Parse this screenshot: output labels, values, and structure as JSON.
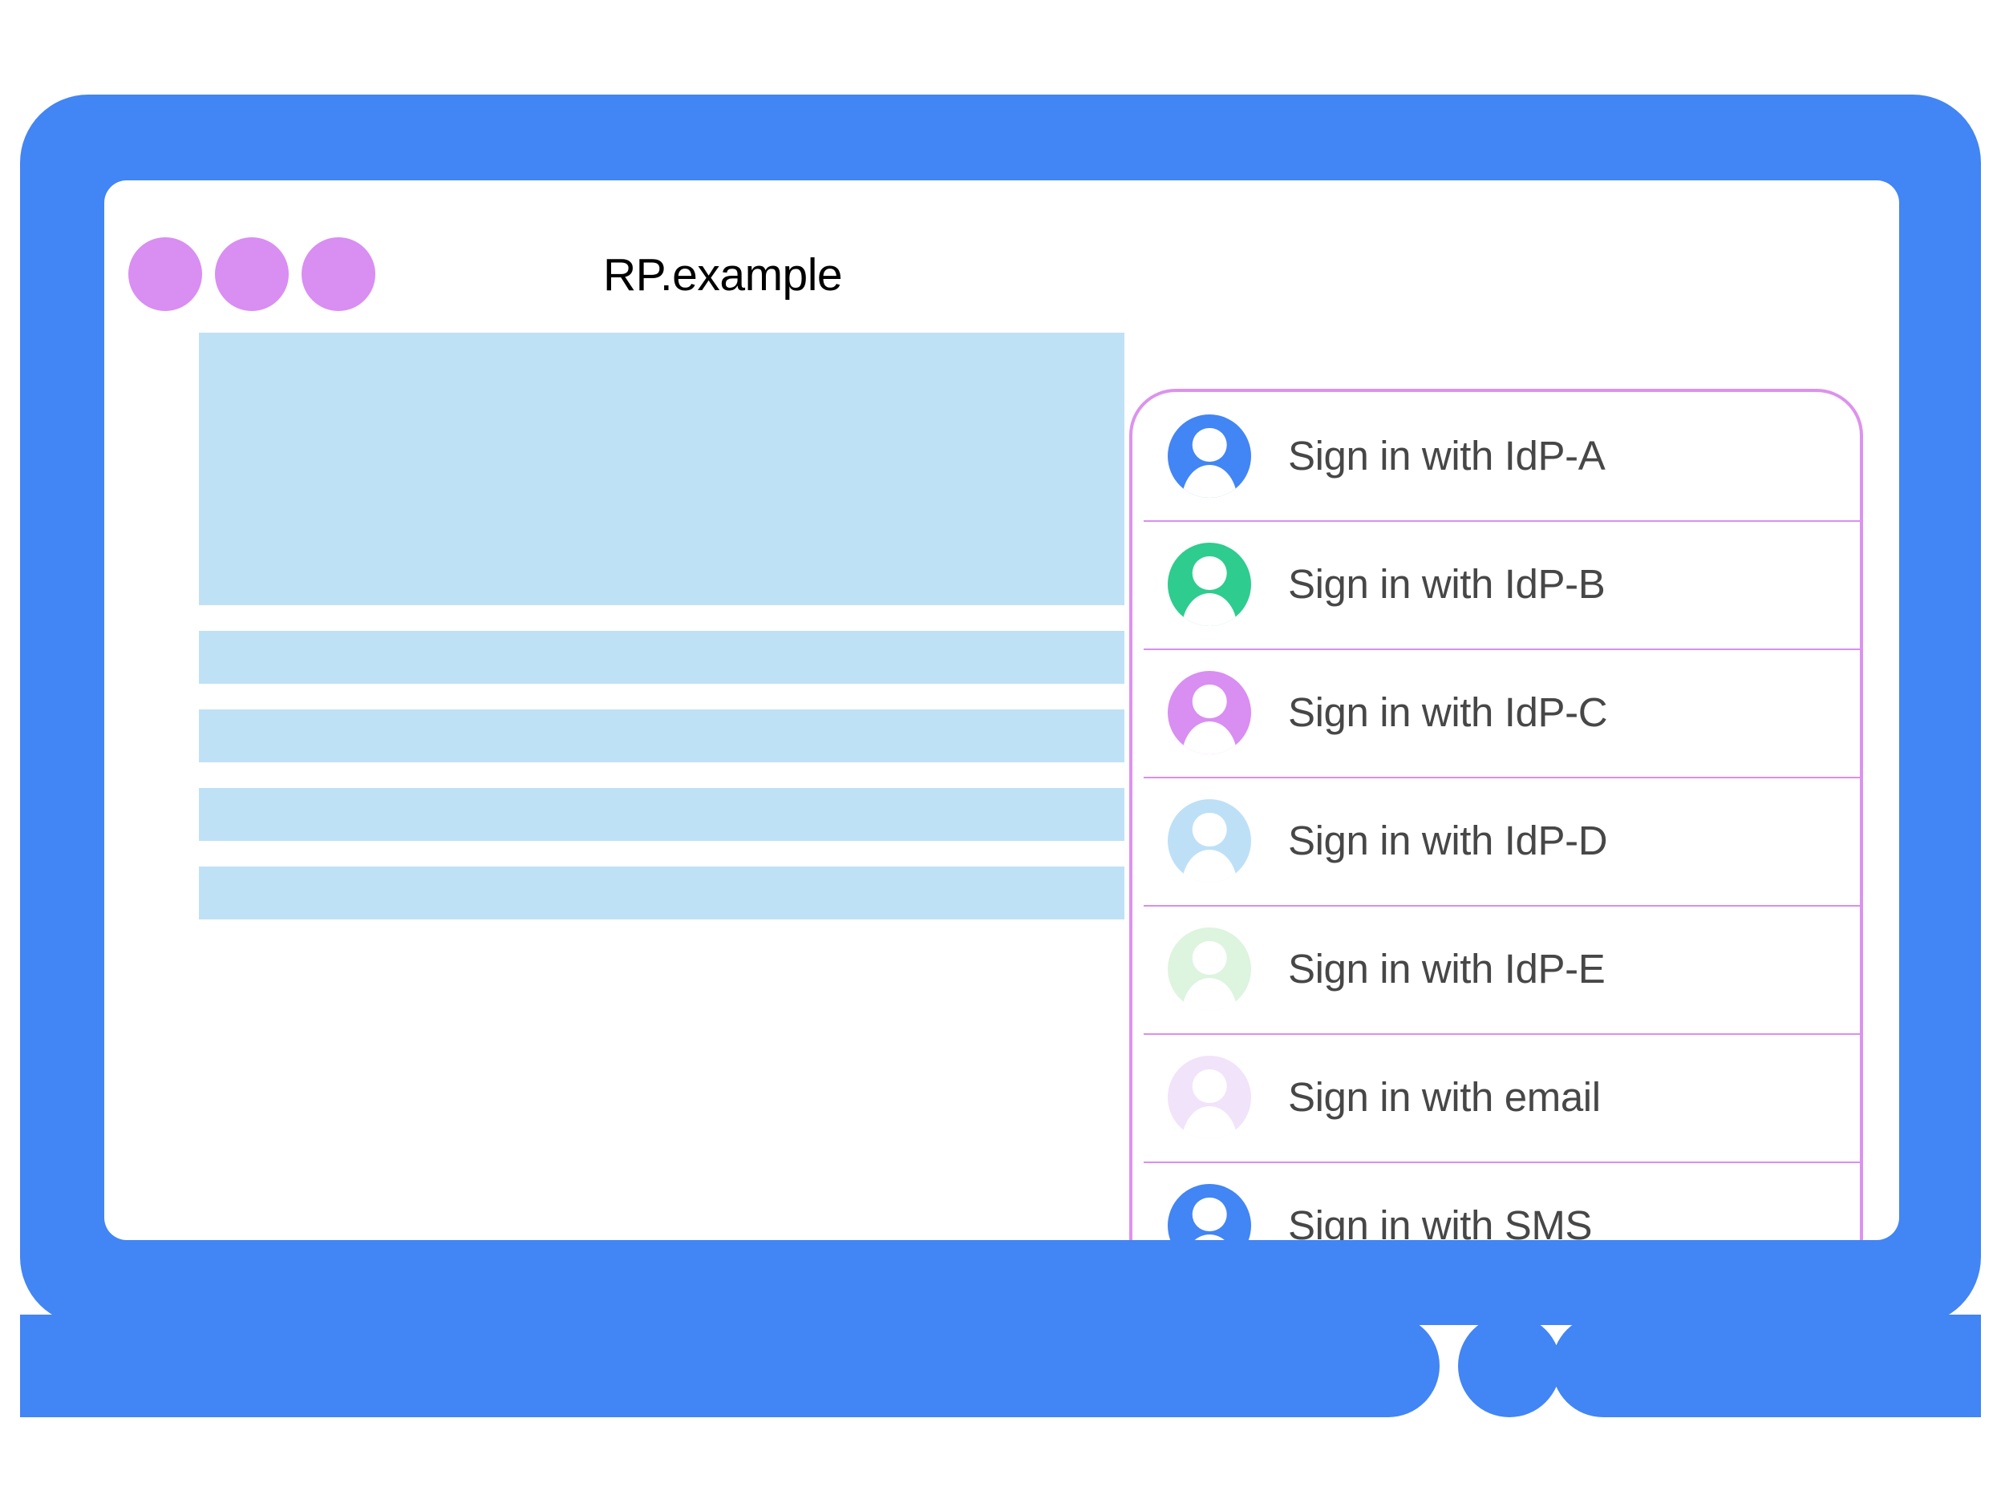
{
  "window": {
    "title": "RP.example",
    "traffic_dots": [
      "dot-1",
      "dot-2",
      "dot-3"
    ],
    "dot_color": "#d98ef2",
    "frame_color": "#4285f4",
    "screen_background": "#ffffff"
  },
  "content": {
    "placeholder_color": "#bfe1f6",
    "blocks": [
      {
        "kind": "hero"
      },
      {
        "kind": "bar"
      },
      {
        "kind": "bar"
      },
      {
        "kind": "bar"
      },
      {
        "kind": "bar"
      }
    ]
  },
  "signin_card": {
    "border_color": "#dd92ee",
    "divider_color": "#d98ef2",
    "label_color": "#474747",
    "items": [
      {
        "label": "Sign in with IdP-A",
        "icon": "avatar-icon",
        "color": "#4285f4"
      },
      {
        "label": "Sign in with IdP-B",
        "icon": "avatar-icon",
        "color": "#2ecc8f"
      },
      {
        "label": "Sign in with IdP-C",
        "icon": "avatar-icon",
        "color": "#d98ef2"
      },
      {
        "label": "Sign in with IdP-D",
        "icon": "avatar-icon",
        "color": "#bde0f7"
      },
      {
        "label": "Sign in with IdP-E",
        "icon": "avatar-icon",
        "color": "#ddf4de"
      },
      {
        "label": "Sign in with email",
        "icon": "avatar-icon",
        "color": "#f1e3fa"
      },
      {
        "label": "Sign in with SMS",
        "icon": "avatar-icon",
        "color": "#4285f4"
      }
    ]
  }
}
